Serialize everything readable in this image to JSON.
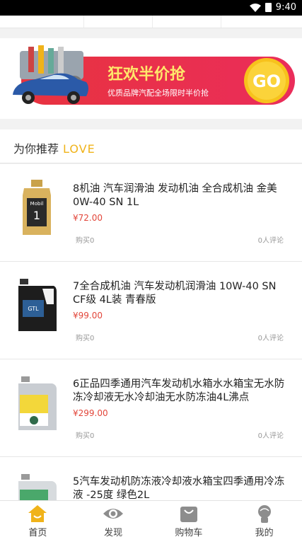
{
  "statusbar": {
    "time": "9:40"
  },
  "banner": {
    "headline": "狂欢半价抢",
    "subline": "优质品牌汽配全场限时半价抢",
    "go": "GO"
  },
  "recommend": {
    "title": "为你推荐",
    "accent": "LOVE"
  },
  "products": [
    {
      "name": "8机油 汽车润滑油 发动机油 全合成机油 金美 0W-40 SN 1L",
      "price": "¥72.00",
      "bought": "购买0",
      "comments": "0人评论"
    },
    {
      "name": "7全合成机油 汽车发动机润滑油 10W-40 SN CF级 4L装 青春版",
      "price": "¥99.00",
      "bought": "购买0",
      "comments": "0人评论"
    },
    {
      "name": "6正品四季通用汽车发动机水箱水水箱宝无水防冻冷却液无水冷却油无水防冻油4L沸点",
      "price": "¥299.00",
      "bought": "购买0",
      "comments": "0人评论"
    },
    {
      "name": "5汽车发动机防冻液冷却液水箱宝四季通用冷冻液 -25度 绿色2L",
      "price": "",
      "bought": "",
      "comments": ""
    }
  ],
  "tabs": [
    {
      "label": "首页",
      "icon": "home-icon"
    },
    {
      "label": "发现",
      "icon": "eye-icon"
    },
    {
      "label": "购物车",
      "icon": "bag-icon"
    },
    {
      "label": "我的",
      "icon": "person-icon"
    }
  ],
  "colors": {
    "accent": "#f0b31a",
    "price": "#e2463a",
    "banner_red": "#e8333f"
  }
}
